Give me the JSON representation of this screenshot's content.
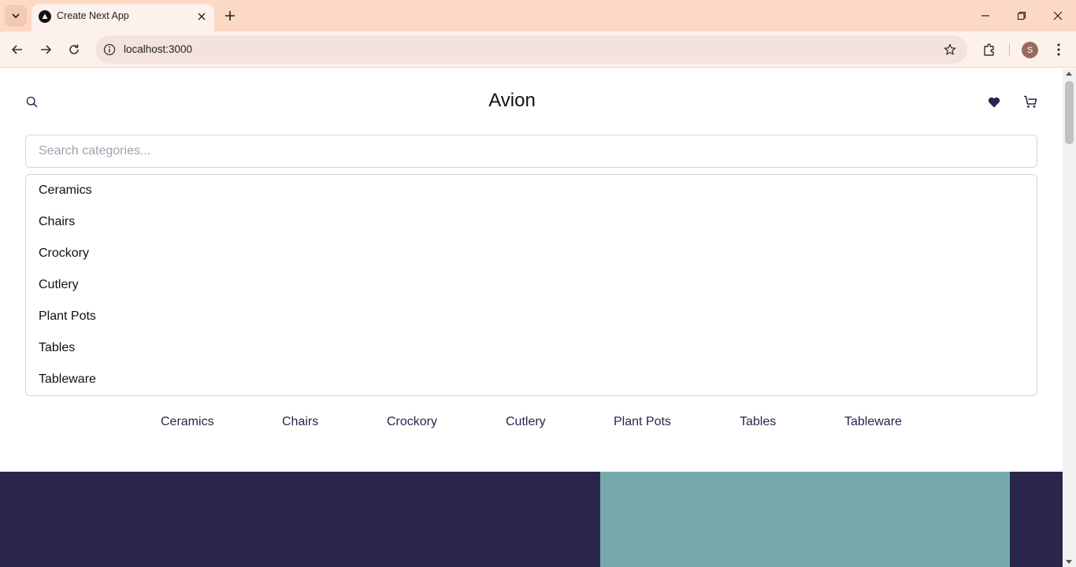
{
  "browser": {
    "tab_title": "Create Next App",
    "url": "localhost:3000",
    "profile_initial": "S"
  },
  "header": {
    "brand": "Avion"
  },
  "search": {
    "placeholder": "Search categories..."
  },
  "dropdown": {
    "options": [
      "Ceramics",
      "Chairs",
      "Crockory",
      "Cutlery",
      "Plant Pots",
      "Tables",
      "Tableware"
    ]
  },
  "category_nav": {
    "items": [
      "Ceramics",
      "Chairs",
      "Crockory",
      "Cutlery",
      "Plant Pots",
      "Tables",
      "Tableware"
    ]
  },
  "colors": {
    "tabstrip": "#fcd9c4",
    "hero_dark": "#2a254b",
    "hero_image": "#77aaad"
  }
}
